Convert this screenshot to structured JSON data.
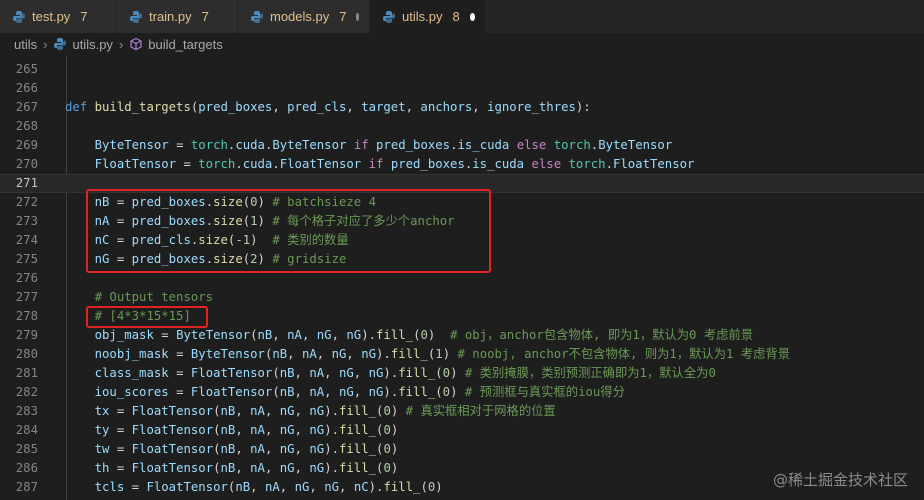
{
  "tabs": [
    {
      "name": "test.py",
      "count": "7",
      "active": false,
      "dot": false
    },
    {
      "name": "train.py",
      "count": "7",
      "active": false,
      "dot": false
    },
    {
      "name": "models.py",
      "count": "7",
      "active": false,
      "dot": true
    },
    {
      "name": "utils.py",
      "count": "8",
      "active": true,
      "dot": true
    }
  ],
  "breadcrumb": {
    "folder": "utils",
    "file": "utils.py",
    "symbol": "build_targets"
  },
  "lines": [
    {
      "n": "265",
      "t": []
    },
    {
      "n": "266",
      "t": []
    },
    {
      "n": "267",
      "t": [
        [
          "def",
          "kw"
        ],
        [
          " "
        ],
        [
          "build_targets",
          "fn"
        ],
        [
          "("
        ],
        [
          "pred_boxes",
          "var"
        ],
        [
          ", "
        ],
        [
          "pred_cls",
          "var"
        ],
        [
          ", "
        ],
        [
          "target",
          "var"
        ],
        [
          ", "
        ],
        [
          "anchors",
          "var"
        ],
        [
          ", "
        ],
        [
          "ignore_thres",
          "var"
        ],
        [
          "):"
        ]
      ]
    },
    {
      "n": "268",
      "t": []
    },
    {
      "n": "269",
      "t": [
        [
          "    "
        ],
        [
          "ByteTensor",
          "var"
        ],
        [
          " = "
        ],
        [
          "torch",
          "cls"
        ],
        [
          "."
        ],
        [
          "cuda",
          "var"
        ],
        [
          "."
        ],
        [
          "ByteTensor",
          "var"
        ],
        [
          " "
        ],
        [
          "if",
          "cf"
        ],
        [
          " "
        ],
        [
          "pred_boxes",
          "var"
        ],
        [
          "."
        ],
        [
          "is_cuda",
          "var"
        ],
        [
          " "
        ],
        [
          "else",
          "cf"
        ],
        [
          " "
        ],
        [
          "torch",
          "cls"
        ],
        [
          "."
        ],
        [
          "ByteTensor",
          "var"
        ]
      ]
    },
    {
      "n": "270",
      "t": [
        [
          "    "
        ],
        [
          "FloatTensor",
          "var"
        ],
        [
          " = "
        ],
        [
          "torch",
          "cls"
        ],
        [
          "."
        ],
        [
          "cuda",
          "var"
        ],
        [
          "."
        ],
        [
          "FloatTensor",
          "var"
        ],
        [
          " "
        ],
        [
          "if",
          "cf"
        ],
        [
          " "
        ],
        [
          "pred_boxes",
          "var"
        ],
        [
          "."
        ],
        [
          "is_cuda",
          "var"
        ],
        [
          " "
        ],
        [
          "else",
          "cf"
        ],
        [
          " "
        ],
        [
          "torch",
          "cls"
        ],
        [
          "."
        ],
        [
          "FloatTensor",
          "var"
        ]
      ]
    },
    {
      "n": "271",
      "t": [],
      "cur": true
    },
    {
      "n": "272",
      "t": [
        [
          "    "
        ],
        [
          "nB",
          "var"
        ],
        [
          " = "
        ],
        [
          "pred_boxes",
          "var"
        ],
        [
          "."
        ],
        [
          "size",
          "fn"
        ],
        [
          "("
        ],
        [
          "0",
          "num"
        ],
        [
          ") "
        ],
        [
          "# batchsieze 4",
          "cm"
        ]
      ]
    },
    {
      "n": "273",
      "t": [
        [
          "    "
        ],
        [
          "nA",
          "var"
        ],
        [
          " = "
        ],
        [
          "pred_boxes",
          "var"
        ],
        [
          "."
        ],
        [
          "size",
          "fn"
        ],
        [
          "("
        ],
        [
          "1",
          "num"
        ],
        [
          ") "
        ],
        [
          "# 每个格子对应了多少个anchor",
          "cm"
        ]
      ]
    },
    {
      "n": "274",
      "t": [
        [
          "    "
        ],
        [
          "nC",
          "var"
        ],
        [
          " = "
        ],
        [
          "pred_cls",
          "var"
        ],
        [
          "."
        ],
        [
          "size",
          "fn"
        ],
        [
          "("
        ],
        [
          "-1",
          "num"
        ],
        [
          ")  "
        ],
        [
          "# 类别的数量",
          "cm"
        ]
      ]
    },
    {
      "n": "275",
      "t": [
        [
          "    "
        ],
        [
          "nG",
          "var"
        ],
        [
          " = "
        ],
        [
          "pred_boxes",
          "var"
        ],
        [
          "."
        ],
        [
          "size",
          "fn"
        ],
        [
          "("
        ],
        [
          "2",
          "num"
        ],
        [
          ") "
        ],
        [
          "# gridsize",
          "cm"
        ]
      ]
    },
    {
      "n": "276",
      "t": []
    },
    {
      "n": "277",
      "t": [
        [
          "    "
        ],
        [
          "# Output tensors",
          "cm"
        ]
      ]
    },
    {
      "n": "278",
      "t": [
        [
          "    "
        ],
        [
          "# [4*3*15*15]",
          "cm"
        ]
      ]
    },
    {
      "n": "279",
      "t": [
        [
          "    "
        ],
        [
          "obj_mask",
          "var"
        ],
        [
          " = "
        ],
        [
          "ByteTensor",
          "var"
        ],
        [
          "("
        ],
        [
          "nB",
          "var"
        ],
        [
          ", "
        ],
        [
          "nA",
          "var"
        ],
        [
          ", "
        ],
        [
          "nG",
          "var"
        ],
        [
          ", "
        ],
        [
          "nG",
          "var"
        ],
        [
          ")."
        ],
        [
          "fill_",
          "fn"
        ],
        [
          "("
        ],
        [
          "0",
          "num"
        ],
        [
          ")  "
        ],
        [
          "# obj，anchor包含物体, 即为1，默认为0 考虑前景",
          "cm"
        ]
      ]
    },
    {
      "n": "280",
      "t": [
        [
          "    "
        ],
        [
          "noobj_mask",
          "var"
        ],
        [
          " = "
        ],
        [
          "ByteTensor",
          "var"
        ],
        [
          "("
        ],
        [
          "nB",
          "var"
        ],
        [
          ", "
        ],
        [
          "nA",
          "var"
        ],
        [
          ", "
        ],
        [
          "nG",
          "var"
        ],
        [
          ", "
        ],
        [
          "nG",
          "var"
        ],
        [
          ")."
        ],
        [
          "fill_",
          "fn"
        ],
        [
          "("
        ],
        [
          "1",
          "num"
        ],
        [
          ") "
        ],
        [
          "# noobj, anchor不包含物体, 则为1，默认为1 考虑背景",
          "cm"
        ]
      ]
    },
    {
      "n": "281",
      "t": [
        [
          "    "
        ],
        [
          "class_mask",
          "var"
        ],
        [
          " = "
        ],
        [
          "FloatTensor",
          "var"
        ],
        [
          "("
        ],
        [
          "nB",
          "var"
        ],
        [
          ", "
        ],
        [
          "nA",
          "var"
        ],
        [
          ", "
        ],
        [
          "nG",
          "var"
        ],
        [
          ", "
        ],
        [
          "nG",
          "var"
        ],
        [
          ")."
        ],
        [
          "fill_",
          "fn"
        ],
        [
          "("
        ],
        [
          "0",
          "num"
        ],
        [
          ") "
        ],
        [
          "# 类别掩膜，类别预测正确即为1，默认全为0",
          "cm"
        ]
      ]
    },
    {
      "n": "282",
      "t": [
        [
          "    "
        ],
        [
          "iou_scores",
          "var"
        ],
        [
          " = "
        ],
        [
          "FloatTensor",
          "var"
        ],
        [
          "("
        ],
        [
          "nB",
          "var"
        ],
        [
          ", "
        ],
        [
          "nA",
          "var"
        ],
        [
          ", "
        ],
        [
          "nG",
          "var"
        ],
        [
          ", "
        ],
        [
          "nG",
          "var"
        ],
        [
          ")."
        ],
        [
          "fill_",
          "fn"
        ],
        [
          "("
        ],
        [
          "0",
          "num"
        ],
        [
          ") "
        ],
        [
          "# 预测框与真实框的iou得分",
          "cm"
        ]
      ]
    },
    {
      "n": "283",
      "t": [
        [
          "    "
        ],
        [
          "tx",
          "var"
        ],
        [
          " = "
        ],
        [
          "FloatTensor",
          "var"
        ],
        [
          "("
        ],
        [
          "nB",
          "var"
        ],
        [
          ", "
        ],
        [
          "nA",
          "var"
        ],
        [
          ", "
        ],
        [
          "nG",
          "var"
        ],
        [
          ", "
        ],
        [
          "nG",
          "var"
        ],
        [
          ")."
        ],
        [
          "fill_",
          "fn"
        ],
        [
          "("
        ],
        [
          "0",
          "num"
        ],
        [
          ") "
        ],
        [
          "# 真实框相对于网格的位置",
          "cm"
        ]
      ]
    },
    {
      "n": "284",
      "t": [
        [
          "    "
        ],
        [
          "ty",
          "var"
        ],
        [
          " = "
        ],
        [
          "FloatTensor",
          "var"
        ],
        [
          "("
        ],
        [
          "nB",
          "var"
        ],
        [
          ", "
        ],
        [
          "nA",
          "var"
        ],
        [
          ", "
        ],
        [
          "nG",
          "var"
        ],
        [
          ", "
        ],
        [
          "nG",
          "var"
        ],
        [
          ")."
        ],
        [
          "fill_",
          "fn"
        ],
        [
          "("
        ],
        [
          "0",
          "num"
        ],
        [
          ")"
        ]
      ]
    },
    {
      "n": "285",
      "t": [
        [
          "    "
        ],
        [
          "tw",
          "var"
        ],
        [
          " = "
        ],
        [
          "FloatTensor",
          "var"
        ],
        [
          "("
        ],
        [
          "nB",
          "var"
        ],
        [
          ", "
        ],
        [
          "nA",
          "var"
        ],
        [
          ", "
        ],
        [
          "nG",
          "var"
        ],
        [
          ", "
        ],
        [
          "nG",
          "var"
        ],
        [
          ")."
        ],
        [
          "fill_",
          "fn"
        ],
        [
          "("
        ],
        [
          "0",
          "num"
        ],
        [
          ")"
        ]
      ]
    },
    {
      "n": "286",
      "t": [
        [
          "    "
        ],
        [
          "th",
          "var"
        ],
        [
          " = "
        ],
        [
          "FloatTensor",
          "var"
        ],
        [
          "("
        ],
        [
          "nB",
          "var"
        ],
        [
          ", "
        ],
        [
          "nA",
          "var"
        ],
        [
          ", "
        ],
        [
          "nG",
          "var"
        ],
        [
          ", "
        ],
        [
          "nG",
          "var"
        ],
        [
          ")."
        ],
        [
          "fill_",
          "fn"
        ],
        [
          "("
        ],
        [
          "0",
          "num"
        ],
        [
          ")"
        ]
      ]
    },
    {
      "n": "287",
      "t": [
        [
          "    "
        ],
        [
          "tcls",
          "var"
        ],
        [
          " = "
        ],
        [
          "FloatTensor",
          "var"
        ],
        [
          "("
        ],
        [
          "nB",
          "var"
        ],
        [
          ", "
        ],
        [
          "nA",
          "var"
        ],
        [
          ", "
        ],
        [
          "nG",
          "var"
        ],
        [
          ", "
        ],
        [
          "nG",
          "var"
        ],
        [
          ", "
        ],
        [
          "nC",
          "var"
        ],
        [
          ")."
        ],
        [
          "fill_",
          "fn"
        ],
        [
          "("
        ],
        [
          "0",
          "num"
        ],
        [
          ")"
        ]
      ]
    }
  ],
  "watermark": "@稀土掘金技术社区",
  "colors": {
    "highlight_box": "#e02424",
    "python_icon": "#4b8bbe"
  }
}
